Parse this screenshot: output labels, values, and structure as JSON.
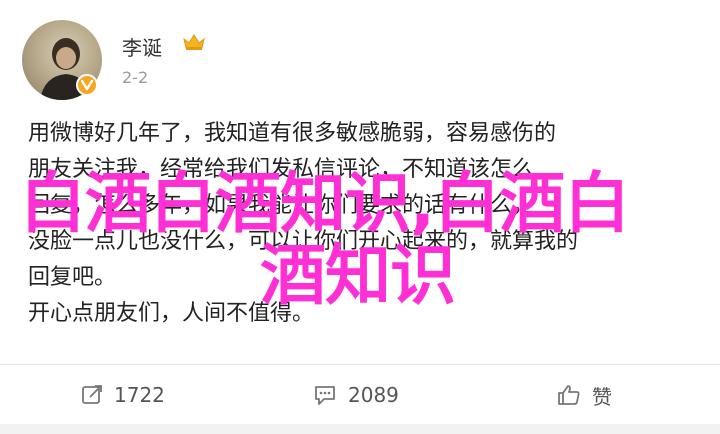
{
  "post": {
    "author": "李诞",
    "timestamp": "2-2",
    "lines": [
      "用微博好几年了，我知道有很多敏感脆弱，容易感伤的",
      "朋友关注我，经常给我们发私信评论，不知道该怎么",
      "回复，怎么多年，如果我能让你们要求的话有什么，",
      "没脸一点儿也没什么，可以让你们开心起来的，就算我的",
      "回复吧。",
      "开心点朋友们，人间不值得。"
    ]
  },
  "watermark": {
    "line1": "白酒白酒知识,白酒白",
    "line2": "酒知识"
  },
  "actions": {
    "repost_count": "1722",
    "comment_count": "2089",
    "like_label": "赞"
  },
  "colors": {
    "watermark": "#ff2fd6",
    "badge": "#f5a623"
  }
}
